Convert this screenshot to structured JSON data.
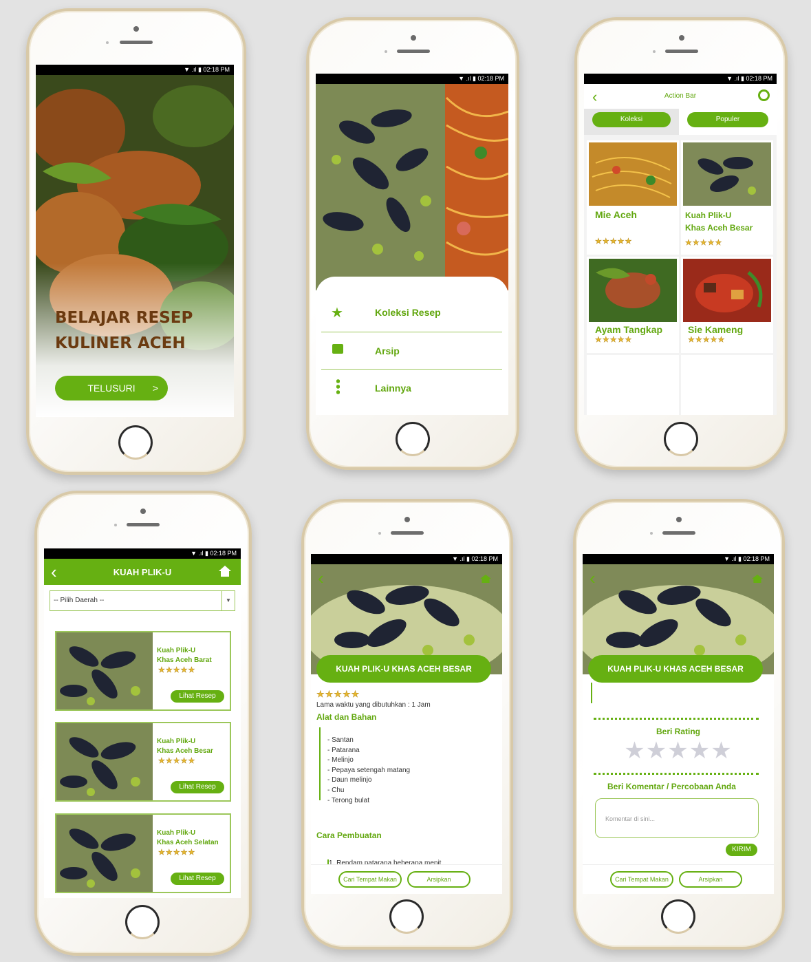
{
  "status_time": "02:18 PM",
  "status_icons": "▼ .ıl ▮",
  "s1": {
    "title_line1": "BELAJAR RESEP",
    "title_line2": "KULINER ACEH",
    "button": "TELUSURI",
    "button_arrow": ">"
  },
  "s2": {
    "menu": [
      {
        "label": "Koleksi Resep",
        "icon": "star-icon"
      },
      {
        "label": "Arsip",
        "icon": "archive-icon"
      },
      {
        "label": "Lainnya",
        "icon": "more-vertical-icon"
      }
    ]
  },
  "s3": {
    "action_bar": "Action Bar",
    "tabs": [
      "Koleksi",
      "Populer"
    ],
    "items": [
      {
        "name": "Mie Aceh"
      },
      {
        "name1": "Kuah Plik-U",
        "name2": "Khas Aceh Besar"
      },
      {
        "name": "Ayam Tangkap"
      },
      {
        "name": "Sie Kameng"
      }
    ],
    "stars": "★★★★★"
  },
  "s4": {
    "title": "KUAH PLIK-U",
    "dropdown": "-- Pilih Daerah --",
    "cards": [
      {
        "l1": "Kuah Plik-U",
        "l2": "Khas Aceh Barat"
      },
      {
        "l1": "Kuah Plik-U",
        "l2": "Khas Aceh Besar"
      },
      {
        "l1": "Kuah Plik-U",
        "l2": "Khas Aceh Selatan"
      }
    ],
    "button": "Lihat Resep",
    "stars": "★★★★★"
  },
  "s5": {
    "title": "KUAH PLIK-U KHAS ACEH BESAR",
    "stars": "★★★★★",
    "time": "Lama waktu yang dibutuhkan : 1 Jam",
    "tools_heading": "Alat dan Bahan",
    "ingredients": [
      "- Santan",
      "- Patarana",
      "- Melinjo",
      "- Pepaya setengah matang",
      "- Daun melinjo",
      "- Chu",
      "- Terong bulat"
    ],
    "method_heading": "Cara Pembuatan",
    "method_first": "1. Rendam patarana beberapa menit",
    "btn_find": "Cari Tempat Makan",
    "btn_archive": "Arsipkan"
  },
  "s6": {
    "title": "KUAH PLIK-U KHAS ACEH BESAR",
    "rating_heading": "Beri Rating",
    "rating_stars": "★★★★★",
    "comment_heading": "Beri Komentar / Percobaan Anda",
    "comment_placeholder": "Komentar di sini...",
    "send": "KIRIM",
    "btn_find": "Cari Tempat Makan",
    "btn_archive": "Arsipkan"
  },
  "colors": {
    "accent": "#66b012",
    "title_brown": "#6b3a10",
    "background": "#e3e3e3"
  }
}
